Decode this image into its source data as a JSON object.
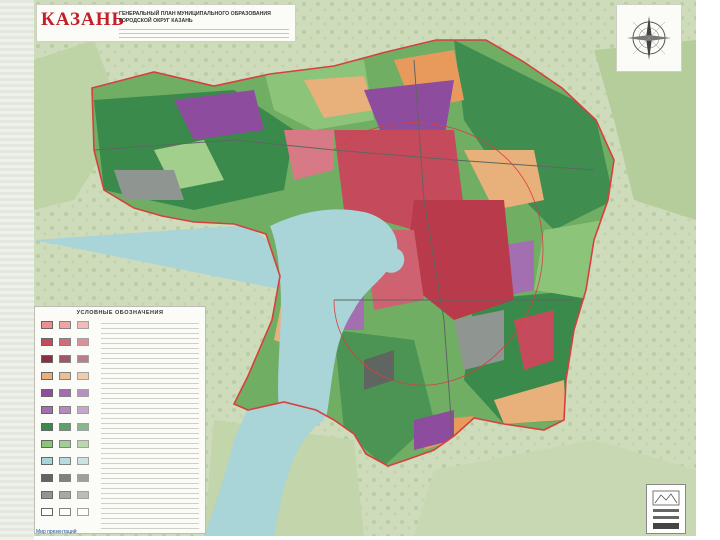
{
  "map": {
    "city_name": "КАЗАНЬ",
    "plan_title_line1": "ГЕНЕРАЛЬНЫЙ ПЛАН МУНИЦИПАЛЬНОГО ОБРАЗОВАНИЯ",
    "plan_title_line2": "ГОРОДСКОЙ ОКРУГ КАЗАНЬ",
    "legend_title": "УСЛОВНЫЕ ОБОЗНАЧЕНИЯ",
    "footer_logo": "Мир презентаций"
  },
  "colors": {
    "boundary": "#d6403f",
    "water": "#a9d4d8",
    "forest": "#3a8a4b",
    "green": "#5caa58",
    "light_green": "#8cc47a",
    "residential": "#c54b5c",
    "dense_residential": "#b83a4b",
    "industrial": "#8e4c9e",
    "lilac": "#a46fb0",
    "sand": "#e8b07a",
    "orange": "#e79a5c",
    "grey": "#8f9590",
    "dark_grey": "#5f6661"
  },
  "legend": {
    "swatches": [
      "#ee8f8f",
      "#c54b5c",
      "#8b3040",
      "#e8b07a",
      "#8e4c9e",
      "#a46fb0",
      "#3a8a4b",
      "#8cc47a",
      "#a9d4d8",
      "#5f6661",
      "#8f9590",
      "#ffffff"
    ]
  }
}
